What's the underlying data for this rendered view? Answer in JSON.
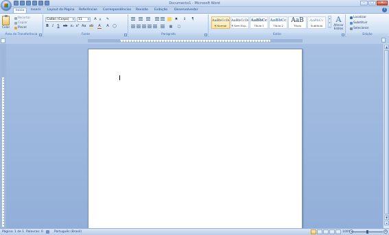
{
  "window": {
    "title": "Documento1 - Microsoft Word"
  },
  "tabs": [
    {
      "label": "Início",
      "active": true
    },
    {
      "label": "Inserir",
      "active": false
    },
    {
      "label": "Layout da Página",
      "active": false
    },
    {
      "label": "Referências",
      "active": false
    },
    {
      "label": "Correspondências",
      "active": false
    },
    {
      "label": "Revisão",
      "active": false
    },
    {
      "label": "Exibição",
      "active": false
    },
    {
      "label": "Desenvolvedor",
      "active": false
    }
  ],
  "clipboard": {
    "paste_label": "Colar",
    "cut_label": "Recortar",
    "copy_label": "Copiar",
    "format_painter_label": "Pincel",
    "group_label": "Área de Transferência"
  },
  "font": {
    "font_name": "Calibri (Corpo)",
    "font_size": "11",
    "group_label": "Fonte"
  },
  "paragraph": {
    "group_label": "Parágrafo"
  },
  "styles": {
    "items": [
      {
        "sample": "AaBbCcDc",
        "name": "¶ Normal",
        "selected": true
      },
      {
        "sample": "AaBbCcDc",
        "name": "¶ Sem Esp...",
        "selected": false
      },
      {
        "sample": "AaBbCc",
        "name": "Título 1",
        "selected": false
      },
      {
        "sample": "AaBbCc",
        "name": "Título 2",
        "selected": false
      },
      {
        "sample": "AaB",
        "name": "Título",
        "selected": false
      },
      {
        "sample": "AaBbCc",
        "name": "Subtítulo",
        "selected": false
      }
    ],
    "change_styles_label": "Alterar Estilos",
    "group_label": "Estilo"
  },
  "editing": {
    "find_label": "Localizar",
    "replace_label": "Substituir",
    "select_label": "Selecionar",
    "group_label": "Edição"
  },
  "status": {
    "page": "Página: 1 de 1",
    "words": "Palavras: 0",
    "language": "Português (Brasil)",
    "zoom": "100%",
    "zoom_value": 100
  },
  "colors": {
    "accent": "#15428b",
    "workspace": "#9fb8dc",
    "selected_style": "#ffe7a2",
    "font_color_bar": "#e03b24",
    "highlight_bar": "#f7e53a"
  }
}
